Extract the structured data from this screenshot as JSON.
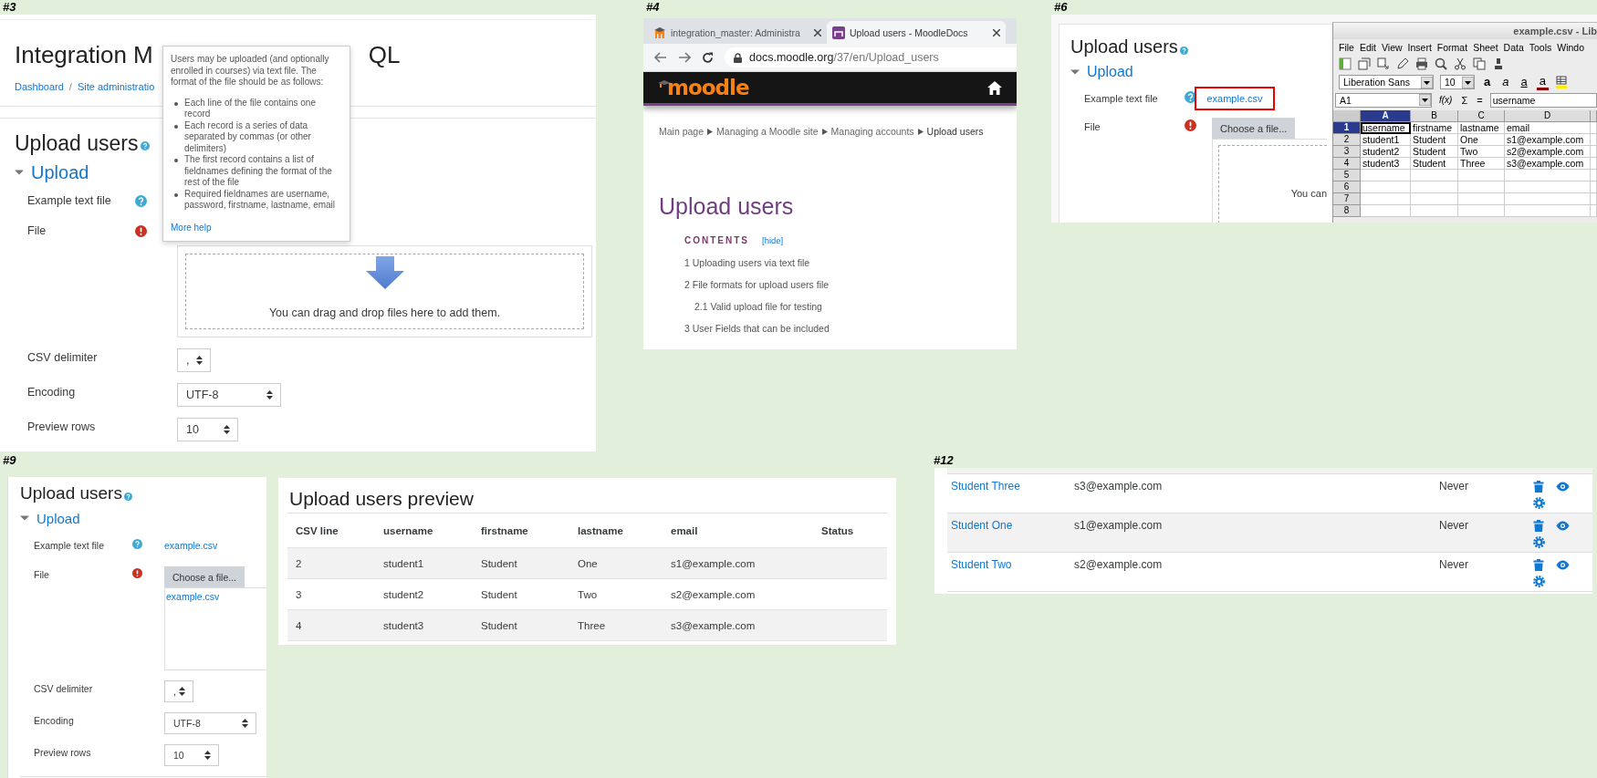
{
  "screenshots": [
    {
      "kind": "moodle_help",
      "number": "#3",
      "page_title": "Integration M",
      "page_title_tail": "QL",
      "breadcrumb": [
        "Dashboard",
        "Site administratio"
      ],
      "breadcrumb_separator": "/",
      "form": {
        "heading": "Upload users",
        "section": "Upload",
        "expanded": true,
        "fields": [
          {
            "kind": "link",
            "label": "Example text file",
            "help": true
          },
          {
            "kind": "filepicker",
            "label": "File",
            "required": true,
            "dropzone_text": "You can drag and drop files here to add them."
          },
          {
            "kind": "select",
            "label": "CSV delimiter",
            "value": ","
          },
          {
            "kind": "select",
            "label": "Encoding",
            "value": "UTF-8"
          },
          {
            "kind": "select",
            "label": "Preview rows",
            "value": "10"
          }
        ]
      },
      "help_popup": {
        "intro": "Users may be uploaded (and optionally enrolled in courses) via text file. The format of the file should be as follows:",
        "points": [
          "Each line of the file contains one record",
          "Each record is a series of data separated by commas (or other delimiters)",
          "The first record contains a list of fieldnames defining the format of the rest of the file",
          "Required fieldnames are username, password, firstname, lastname, email"
        ],
        "link": "More help"
      }
    },
    {
      "kind": "browser_docs",
      "number": "#4",
      "tabs": [
        {
          "title": "integration_master: Administra",
          "selected": false
        },
        {
          "title": "Upload users - MoodleDocs",
          "selected": true
        }
      ],
      "url_host": "docs.moodle.org",
      "url_path": "/37/en/Upload_users",
      "logo": "moodle",
      "breadcrumb": [
        "Main page",
        "Managing a Moodle site",
        "Managing accounts",
        "Upload users"
      ],
      "heading": "Upload users",
      "contents_title": "CONTENTS",
      "contents_toggle": "[hide]",
      "contents": [
        {
          "text": "1 Uploading users via text file"
        },
        {
          "text": "2 File formats for upload users file",
          "children": [
            {
              "text": "2.1 Valid upload file for testing"
            }
          ]
        },
        {
          "text": "3 User Fields that can be included"
        }
      ]
    },
    {
      "kind": "moodle_spreadsheet",
      "number": "#6",
      "form": {
        "heading": "Upload users",
        "section": "Upload",
        "expanded": true,
        "fields": [
          {
            "kind": "link",
            "label": "Example text file",
            "help": true,
            "value": "example.csv",
            "highlighted": true
          },
          {
            "kind": "filepicker",
            "label": "File",
            "required": true,
            "button": "Choose a file...",
            "dropzone_text": "You can"
          }
        ]
      },
      "spreadsheet": {
        "title": "example.csv - Lib",
        "menu": [
          "File",
          "Edit",
          "View",
          "Insert",
          "Format",
          "Sheet",
          "Data",
          "Tools",
          "Windo"
        ],
        "font_name": "Liberation Sans",
        "font_size": "10",
        "format_buttons": [
          {
            "kind": "bold",
            "text": "a"
          },
          {
            "kind": "italic",
            "text": "a"
          },
          {
            "kind": "underline",
            "text": "a"
          },
          {
            "kind": "font_color",
            "text": "a"
          }
        ],
        "cell_ref": "A1",
        "formula_buttons": [
          "f(x)",
          "Σ",
          "="
        ],
        "formula": "username",
        "columns": [
          {
            "label": "A",
            "selected": true
          },
          {
            "label": "B",
            "selected": false
          },
          {
            "label": "C",
            "selected": false
          },
          {
            "label": "D",
            "selected": false
          }
        ],
        "rows": [
          {
            "number": "1",
            "selected": true,
            "cells": [
              "username",
              "firstname",
              "lastname",
              "email"
            ]
          },
          {
            "number": "2",
            "selected": false,
            "cells": [
              "student1",
              "Student",
              "One",
              "s1@example.com"
            ]
          },
          {
            "number": "3",
            "selected": false,
            "cells": [
              "student2",
              "Student",
              "Two",
              "s2@example.com"
            ]
          },
          {
            "number": "4",
            "selected": false,
            "cells": [
              "student3",
              "Student",
              "Three",
              "s3@example.com"
            ]
          },
          {
            "number": "5",
            "selected": false
          },
          {
            "number": "6",
            "selected": false
          },
          {
            "number": "7",
            "selected": false
          },
          {
            "number": "8",
            "selected": false
          }
        ]
      }
    },
    {
      "kind": "moodle_preview",
      "number": "#9",
      "form": {
        "heading": "Upload users",
        "section": "Upload",
        "expanded": true,
        "fields": [
          {
            "kind": "link",
            "label": "Example text file",
            "help": true,
            "value": "example.csv",
            "highlighted": false
          },
          {
            "kind": "filepicker",
            "label": "File",
            "required": true,
            "button": "Choose a file...",
            "files": [
              "example.csv"
            ]
          },
          {
            "kind": "select",
            "label": "CSV delimiter",
            "value": ","
          },
          {
            "kind": "select",
            "label": "Encoding",
            "value": "UTF-8"
          },
          {
            "kind": "select",
            "label": "Preview rows",
            "value": "10"
          }
        ]
      },
      "preview": {
        "title": "Upload users preview",
        "columns": [
          "CSV line",
          "username",
          "firstname",
          "lastname",
          "email",
          "Status"
        ],
        "rows": [
          [
            "2",
            "student1",
            "Student",
            "One",
            "s1@example.com"
          ],
          [
            "3",
            "student2",
            "Student",
            "Two",
            "s2@example.com"
          ],
          [
            "4",
            "student3",
            "Student",
            "Three",
            "s3@example.com"
          ]
        ]
      }
    },
    {
      "kind": "user_list",
      "number": "#12",
      "rows": [
        {
          "name": "Student Three",
          "email": "s3@example.com",
          "last_access": "Never"
        },
        {
          "name": "Student One",
          "email": "s1@example.com",
          "last_access": "Never"
        },
        {
          "name": "Student Two",
          "email": "s2@example.com",
          "last_access": "Never"
        }
      ]
    }
  ]
}
